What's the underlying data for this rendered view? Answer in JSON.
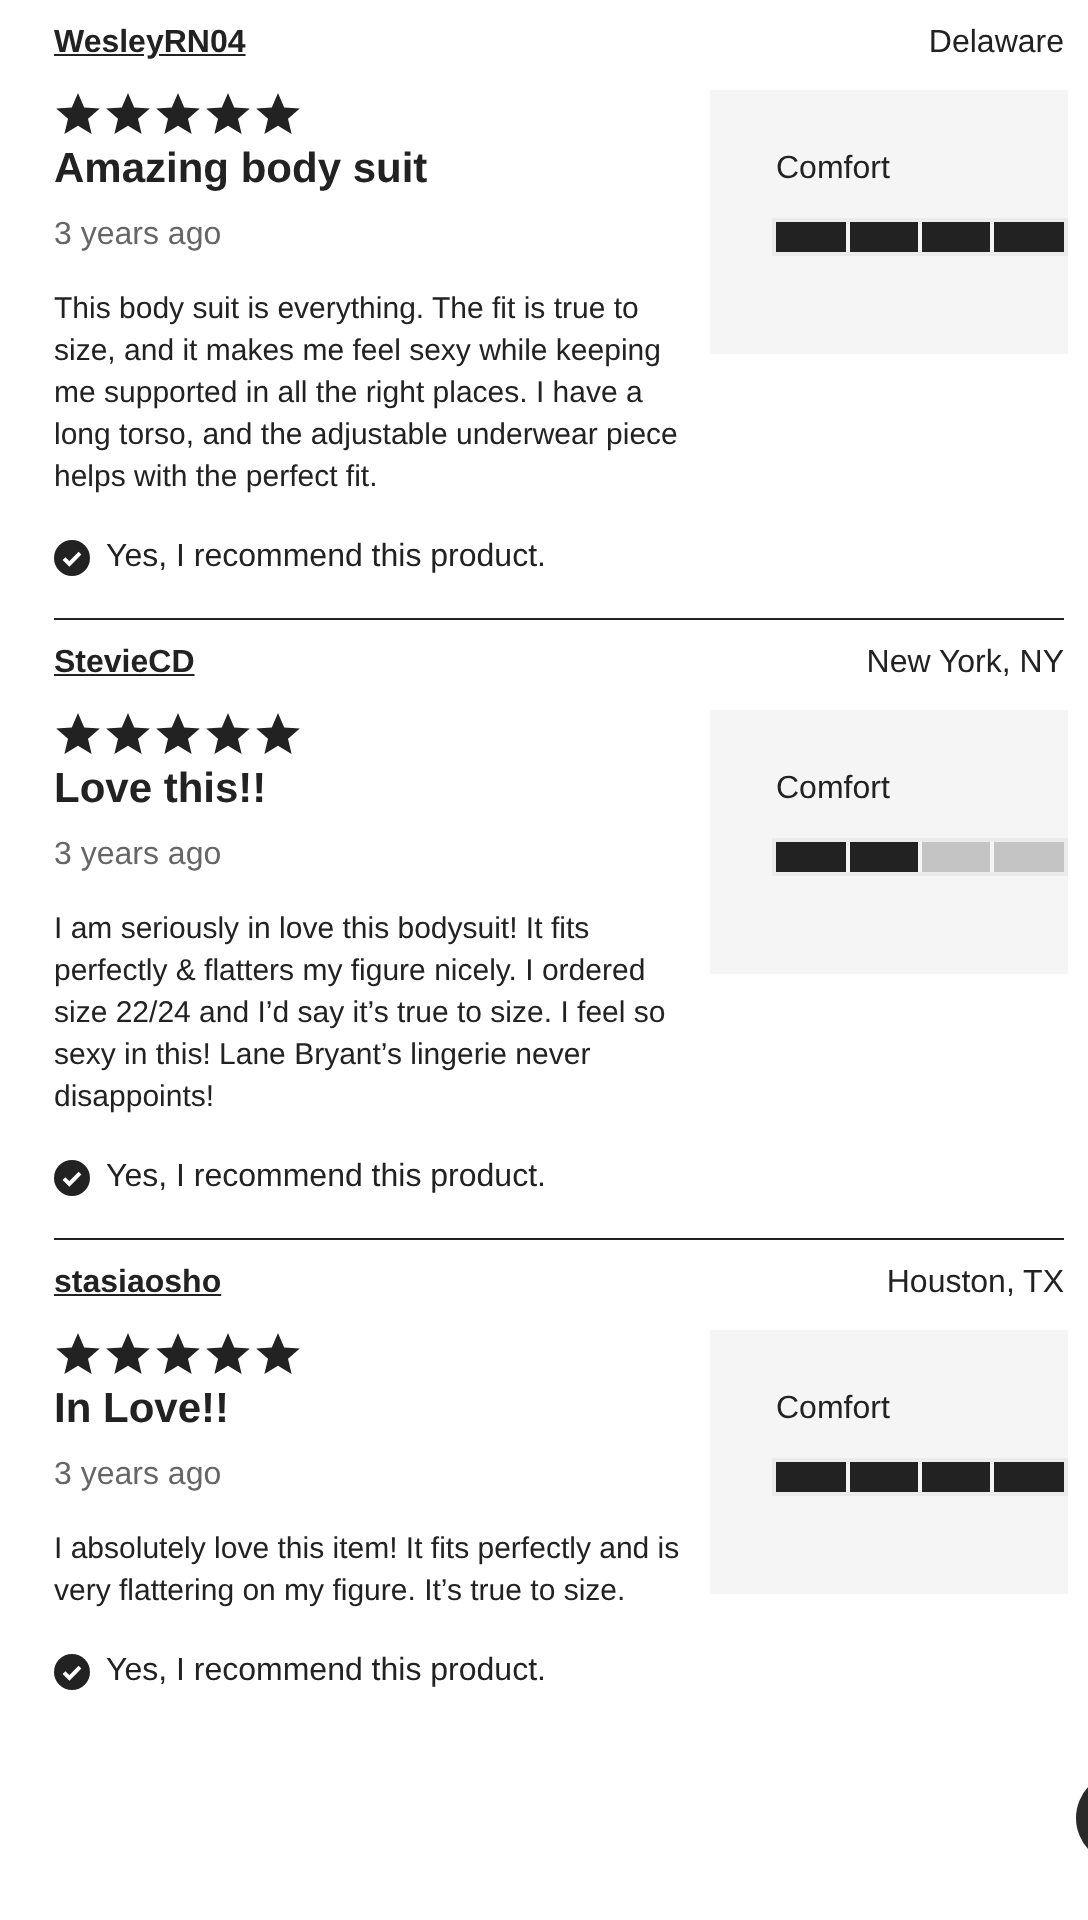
{
  "reviews": [
    {
      "author": "WesleyRN04",
      "location": "Delaware",
      "stars": 5,
      "title": "Amazing body suit",
      "date": "3 years ago",
      "body": "This body suit is everything. The fit is true to size, and it makes me feel sexy while keeping me supported in all the right places. I have a long torso, and the adjustable underwear piece helps with the perfect fit.",
      "rating_label": "Comfort",
      "level": 1,
      "recommend": "Yes, I recommend this product."
    },
    {
      "author": "StevieCD",
      "location": "New York, NY",
      "stars": 5,
      "title": "Love this!!",
      "date": "3 years ago",
      "body": "I am seriously in love this bodysuit! It fits perfectly & flatters my figure nicely. I ordered size 22/24 and I’d say it’s true to size. I feel so sexy in this! Lane Bryant’s lingerie never disappoints!",
      "rating_label": "Comfort",
      "level": 0.5,
      "recommend": "Yes, I recommend this product."
    },
    {
      "author": "stasiaosho",
      "location": "Houston, TX",
      "stars": 5,
      "title": "In Love!!",
      "date": "3 years ago",
      "body": "I absolutely love this item! It fits perfectly and is very flattering on my figure. It’s true to size.",
      "rating_label": "Comfort",
      "level": 1,
      "recommend": "Yes, I recommend this product."
    }
  ]
}
